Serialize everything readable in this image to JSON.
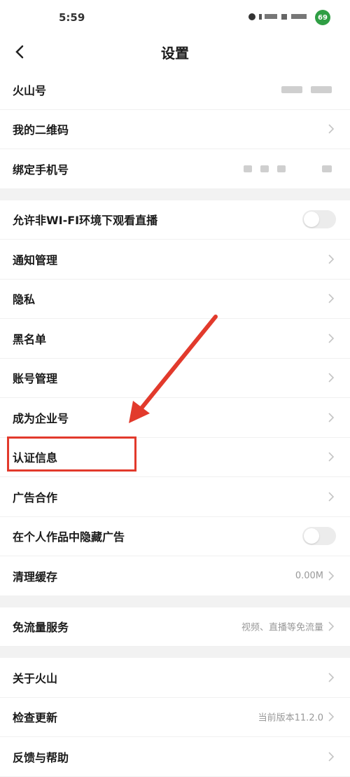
{
  "status": {
    "time": "5:59",
    "battery": "69"
  },
  "nav": {
    "title": "设置"
  },
  "groups": [
    {
      "items": [
        {
          "label": "火山号",
          "type": "blurred"
        },
        {
          "label": "我的二维码",
          "type": "chevron"
        },
        {
          "label": "绑定手机号",
          "type": "blurred"
        }
      ]
    },
    {
      "items": [
        {
          "label": "允许非WI-FI环境下观看直播",
          "type": "toggle"
        },
        {
          "label": "通知管理",
          "type": "chevron"
        },
        {
          "label": "隐私",
          "type": "chevron"
        },
        {
          "label": "黑名单",
          "type": "chevron"
        },
        {
          "label": "账号管理",
          "type": "chevron"
        },
        {
          "label": "成为企业号",
          "type": "chevron"
        },
        {
          "label": "认证信息",
          "type": "chevron"
        },
        {
          "label": "广告合作",
          "type": "chevron"
        },
        {
          "label": "在个人作品中隐藏广告",
          "type": "toggle"
        },
        {
          "label": "清理缓存",
          "type": "value",
          "value": "0.00M"
        }
      ]
    },
    {
      "items": [
        {
          "label": "免流量服务",
          "type": "value",
          "value": "视频、直播等免流量"
        }
      ]
    },
    {
      "items": [
        {
          "label": "关于火山",
          "type": "chevron"
        },
        {
          "label": "检查更新",
          "type": "value",
          "value": "当前版本11.2.0"
        },
        {
          "label": "反馈与帮助",
          "type": "chevron"
        }
      ]
    }
  ],
  "colors": {
    "highlight": "#e23a2c",
    "toggle_off": "#ececec"
  },
  "icons": {
    "back": "chevron-left-icon",
    "row": "chevron-right-icon"
  }
}
